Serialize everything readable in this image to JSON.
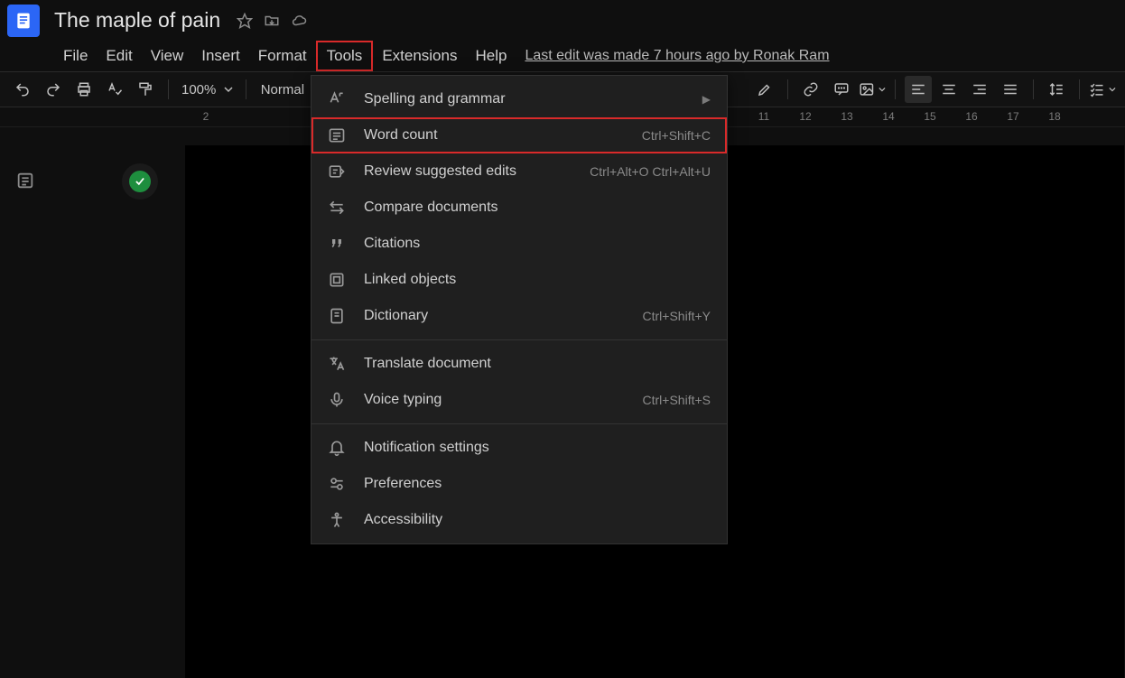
{
  "header": {
    "doc_title": "The maple of pain",
    "last_edit": "Last edit was made 7 hours ago by Ronak Ram"
  },
  "menu": {
    "file": "File",
    "edit": "Edit",
    "view": "View",
    "insert": "Insert",
    "format": "Format",
    "tools": "Tools",
    "extensions": "Extensions",
    "help": "Help"
  },
  "toolbar": {
    "zoom": "100%",
    "style": "Normal"
  },
  "ruler": {
    "r2": "2",
    "r11": "11",
    "r12": "12",
    "r13": "13",
    "r14": "14",
    "r15": "15",
    "r16": "16",
    "r17": "17",
    "r18": "18"
  },
  "dropdown": {
    "spelling": {
      "label": "Spelling and grammar",
      "shortcut": ""
    },
    "wordcount": {
      "label": "Word count",
      "shortcut": "Ctrl+Shift+C"
    },
    "review": {
      "label": "Review suggested edits",
      "shortcut": "Ctrl+Alt+O Ctrl+Alt+U"
    },
    "compare": {
      "label": "Compare documents",
      "shortcut": ""
    },
    "citations": {
      "label": "Citations",
      "shortcut": ""
    },
    "linked": {
      "label": "Linked objects",
      "shortcut": ""
    },
    "dictionary": {
      "label": "Dictionary",
      "shortcut": "Ctrl+Shift+Y"
    },
    "translate": {
      "label": "Translate document",
      "shortcut": ""
    },
    "voice": {
      "label": "Voice typing",
      "shortcut": "Ctrl+Shift+S"
    },
    "notif": {
      "label": "Notification settings",
      "shortcut": ""
    },
    "prefs": {
      "label": "Preferences",
      "shortcut": ""
    },
    "access": {
      "label": "Accessibility",
      "shortcut": ""
    }
  }
}
